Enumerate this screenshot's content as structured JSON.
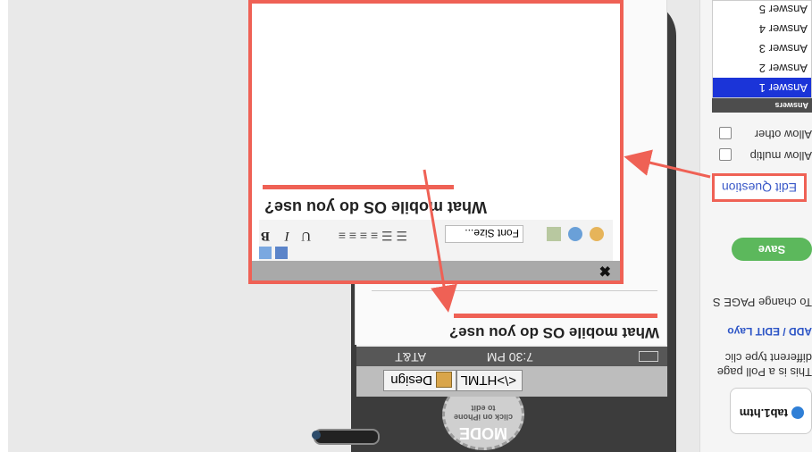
{
  "phone": {
    "carrier": "AT&T",
    "time": "7:30 PM",
    "question": "What mobile OS do you use?",
    "tabs": [
      "Design",
      "<\\>HTML"
    ],
    "mode_badge": {
      "title": "MODE",
      "subtitle": "click on iPhone to edit"
    }
  },
  "editor": {
    "question": "What mobile OS do you use?",
    "close_label": "✖",
    "font_size_label": "Font Size...",
    "format_buttons": [
      "B",
      "I",
      "U"
    ]
  },
  "right_pane": {
    "edit_question_label": "Edit Question",
    "save_label": "Save",
    "allow_multiple_label": "Allow multip",
    "allow_other_label": "Allow other",
    "answers_header": "Answers",
    "answers": [
      "Answer 1",
      "Answer 2",
      "Answer 3",
      "Answer 4",
      "Answer 5"
    ],
    "add_edit_layout_link": "ADD / EDIT Layo",
    "page_hint": "To change PAGE S",
    "poll_hint_1": "This is a Poll page",
    "poll_hint_2": "different type clic",
    "file_tab": "tab1.htm"
  },
  "colors": {
    "accent": "#ef6155",
    "selected": "#1b34d8",
    "save": "#5cb85c"
  }
}
